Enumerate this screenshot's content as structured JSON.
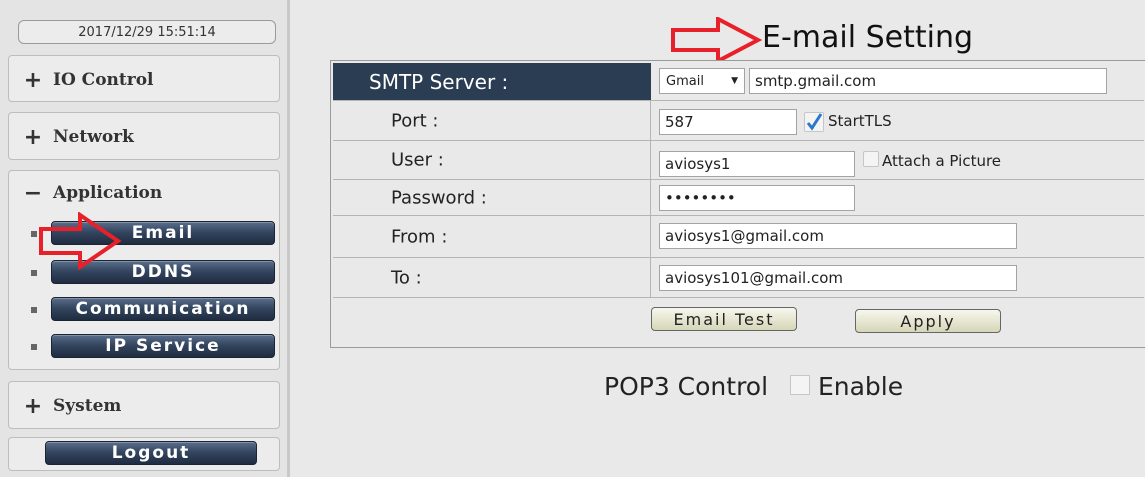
{
  "sidebar": {
    "datetime": "2017/12/29 15:51:14",
    "io_control": {
      "sign": "+",
      "label": "IO Control"
    },
    "network": {
      "sign": "+",
      "label": "Network"
    },
    "application": {
      "sign": "−",
      "label": "Application",
      "items": [
        "Email",
        "DDNS",
        "Communication",
        "IP Service"
      ]
    },
    "system": {
      "sign": "+",
      "label": "System"
    },
    "logout": "Logout"
  },
  "main": {
    "title": "E-mail Setting",
    "smtp_server_label": "SMTP Server :",
    "provider_select": "Gmail",
    "smtp_host": "smtp.gmail.com",
    "port_label": "Port :",
    "port_value": "587",
    "starttls_label": "StartTLS",
    "starttls_checked": true,
    "user_label": "User :",
    "user_value": "aviosys1",
    "attach_picture_label": "Attach a Picture",
    "attach_picture_checked": false,
    "password_label": "Password :",
    "password_value": "••••••••",
    "from_label": "From :",
    "from_value": "aviosys1@gmail.com",
    "to_label": "To :",
    "to_value": "aviosys101@gmail.com",
    "email_test_button": "Email Test",
    "apply_button": "Apply",
    "pop3_label": "POP3 Control",
    "pop3_enable_label": "Enable",
    "pop3_enabled": false
  },
  "colors": {
    "nav_button": "#2b3d52",
    "smtp_header": "#2b3d52",
    "annotation_arrow": "#e8202a",
    "check_mark": "#2c78c8"
  },
  "icons": {
    "annotation": "red-outline-arrow-icon",
    "checkbox_checked": "check-icon",
    "dropdown": "caret-down-icon"
  }
}
